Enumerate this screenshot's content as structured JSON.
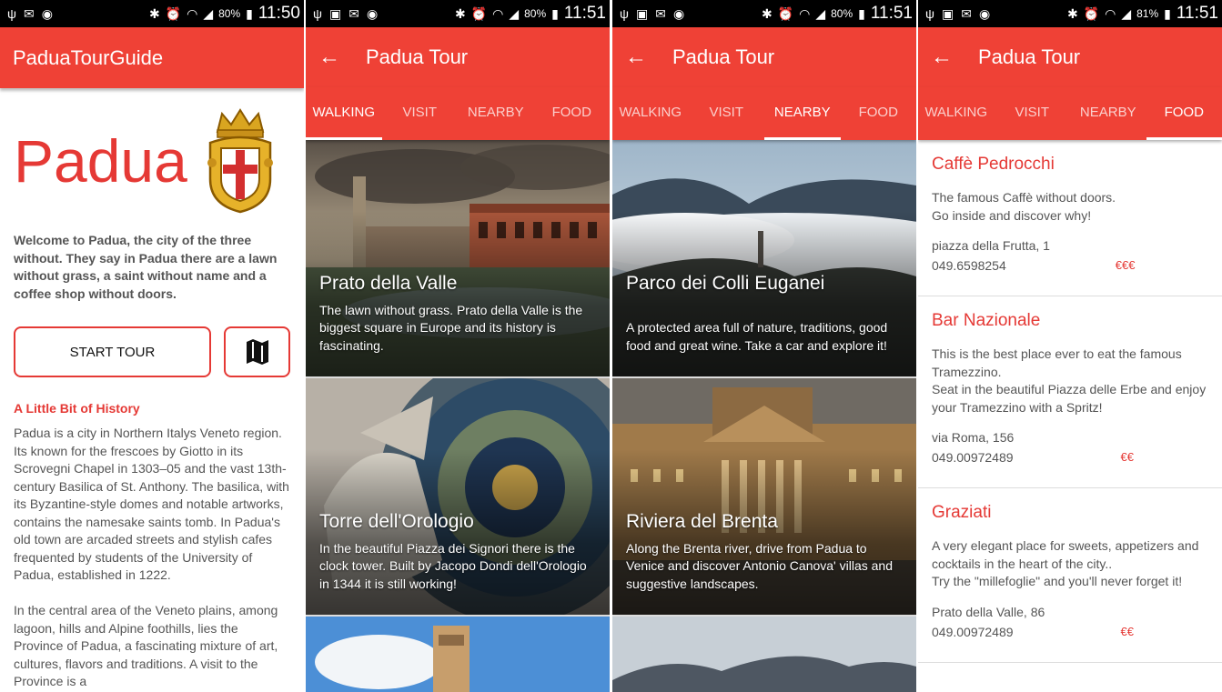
{
  "status_bars": [
    {
      "battery": "80%",
      "time": "11:50"
    },
    {
      "battery": "80%",
      "time": "11:51"
    },
    {
      "battery": "80%",
      "time": "11:51"
    },
    {
      "battery": "81%",
      "time": "11:51"
    }
  ],
  "home": {
    "app_title": "PaduaTourGuide",
    "city_title": "Padua",
    "welcome": "Welcome to Padua, the city of the three without. They say in Padua there are a lawn without grass, a saint without name and a coffee shop without doors.",
    "start_tour_label": "START TOUR",
    "history_title": "A Little Bit of History",
    "history_p1": "Padua is a city in Northern Italys Veneto region. Its known for the frescoes by Giotto in its Scrovegni Chapel in 1303–05 and the vast 13th-century Basilica of St. Anthony. The basilica, with its Byzantine-style domes and notable artworks, contains the namesake saints tomb. In Padua's old town are arcaded streets and stylish cafes frequented by students of the University of Padua, established in 1222.",
    "history_p2": "In the central area of the Veneto plains, among lagoon, hills and Alpine foothills, lies the Province of Padua, a fascinating mixture of art, cultures, flavors and traditions. A visit to the Province is a"
  },
  "tour": {
    "title": "Padua Tour",
    "tabs": [
      "WALKING",
      "VISIT",
      "NEARBY",
      "FOOD"
    ]
  },
  "walking": [
    {
      "title": "Prato della Valle",
      "text": "The lawn without grass. Prato della Valle is the biggest square in Europe and its history is fascinating."
    },
    {
      "title": "Torre dell'Orologio",
      "text": "In the beautiful Piazza dei Signori there is the clock tower. Built by Jacopo Dondi dell'Orologio in 1344 it is still working!"
    }
  ],
  "nearby": [
    {
      "title": "Parco dei Colli Euganei",
      "text": "A protected area full of nature, traditions, good food and great wine. Take a car and explore it!"
    },
    {
      "title": "Riviera del Brenta",
      "text": "Along the Brenta river, drive from Padua to Venice and discover Antonio Canova' villas and suggestive landscapes."
    }
  ],
  "food": [
    {
      "name": "Caffè Pedrocchi",
      "desc": "The famous Caffè without doors.\nGo inside and discover why!",
      "address": "piazza della Frutta, 1",
      "phone": "049.6598254",
      "price": "€€€"
    },
    {
      "name": "Bar Nazionale",
      "desc": "This is the best place ever to eat the famous Tramezzino.\nSeat in the beautiful Piazza delle Erbe and enjoy your Tramezzino with a Spritz!",
      "address": "via Roma, 156",
      "phone": "049.00972489",
      "price": "€€"
    },
    {
      "name": "Graziati",
      "desc": "A very elegant place for sweets, appetizers and cocktails in the heart of the city..\nTry the \"millefoglie\" and you'll never forget it!",
      "address": "Prato della Valle, 86",
      "phone": "049.00972489",
      "price": "€€"
    }
  ],
  "colors": {
    "primary": "#ef4136",
    "accent_text": "#e53935"
  },
  "icons": [
    "usb-icon",
    "mail-icon",
    "spotify-icon",
    "image-icon",
    "bluetooth-icon",
    "alarm-icon",
    "wifi-icon",
    "signal-icon",
    "battery-icon",
    "back-arrow-icon",
    "map-icon",
    "padua-crest-icon"
  ]
}
